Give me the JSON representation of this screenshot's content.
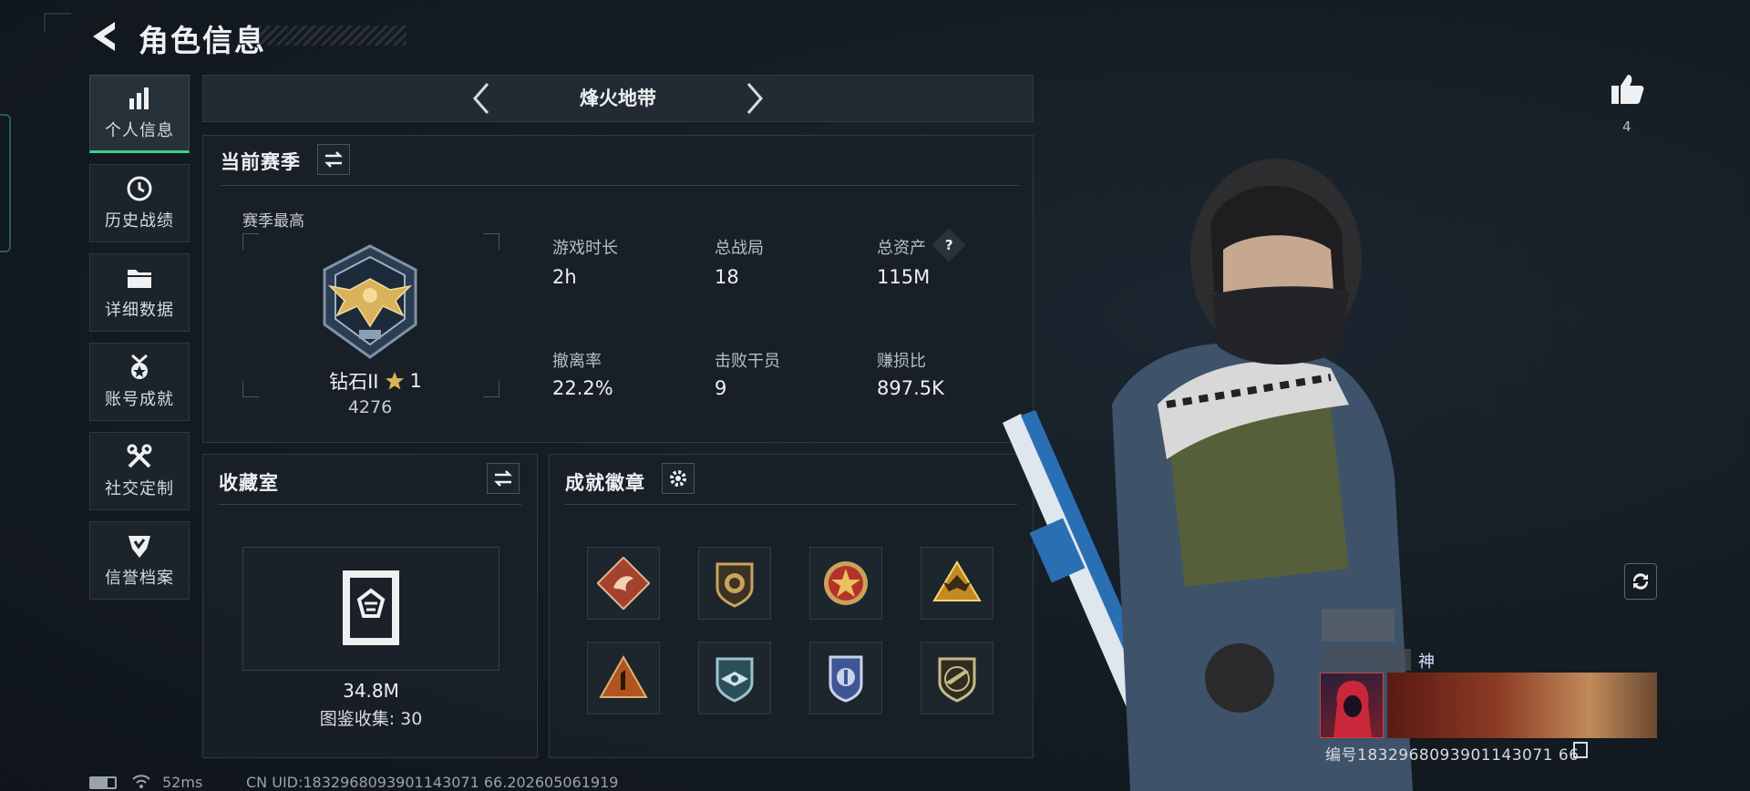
{
  "header": {
    "title": "角色信息"
  },
  "nav": [
    {
      "label": "个人信息",
      "icon": "bar-chart-icon",
      "active": true
    },
    {
      "label": "历史战绩",
      "icon": "clock-history-icon",
      "active": false
    },
    {
      "label": "详细数据",
      "icon": "folder-icon",
      "active": false
    },
    {
      "label": "账号成就",
      "icon": "medal-icon",
      "active": false
    },
    {
      "label": "社交定制",
      "icon": "wrench-cross-icon",
      "active": false
    },
    {
      "label": "信誉档案",
      "icon": "shield-check-icon",
      "active": false
    }
  ],
  "mode": {
    "name": "烽火地带"
  },
  "season": {
    "title": "当前赛季",
    "best_label": "赛季最高",
    "rank_name": "钻石II",
    "rank_stars": "1",
    "rank_score": "4276",
    "stats": [
      {
        "label": "游戏时长",
        "value": "2h"
      },
      {
        "label": "总战局",
        "value": "18"
      },
      {
        "label": "总资产",
        "value": "115M",
        "help": "?"
      },
      {
        "label": "撤离率",
        "value": "22.2%"
      },
      {
        "label": "击败干员",
        "value": "9"
      },
      {
        "label": "赚损比",
        "value": "897.5K"
      }
    ]
  },
  "collection": {
    "title": "收藏室",
    "value": "34.8M",
    "count_text": "图鉴收集: 30"
  },
  "achievements": {
    "title": "成就徽章",
    "badges": [
      {
        "icon": "dragon-badge-icon",
        "color": "#a5412f"
      },
      {
        "icon": "lion-badge-icon",
        "color": "#8a6a35"
      },
      {
        "icon": "star-badge-icon",
        "color": "#b5322a"
      },
      {
        "icon": "gold-eagle-badge-icon",
        "color": "#c58a1f"
      },
      {
        "icon": "number-one-badge-icon",
        "color": "#b0551f"
      },
      {
        "icon": "wings-badge-icon",
        "color": "#3b6e7c"
      },
      {
        "icon": "police-badge-icon",
        "color": "#3f5596"
      },
      {
        "icon": "rifle-badge-icon",
        "color": "#7a6a3e"
      }
    ]
  },
  "profile": {
    "likes": "4",
    "name_suffix": "神",
    "id_text": "编号1832968093901143071 66"
  },
  "status_bar": {
    "ping": "52ms",
    "uid": "CN UID:1832968093901143071 66.202605061919"
  },
  "colors": {
    "accent": "#3ad08a",
    "panel": "#192027",
    "gold": "#d9b25b"
  }
}
